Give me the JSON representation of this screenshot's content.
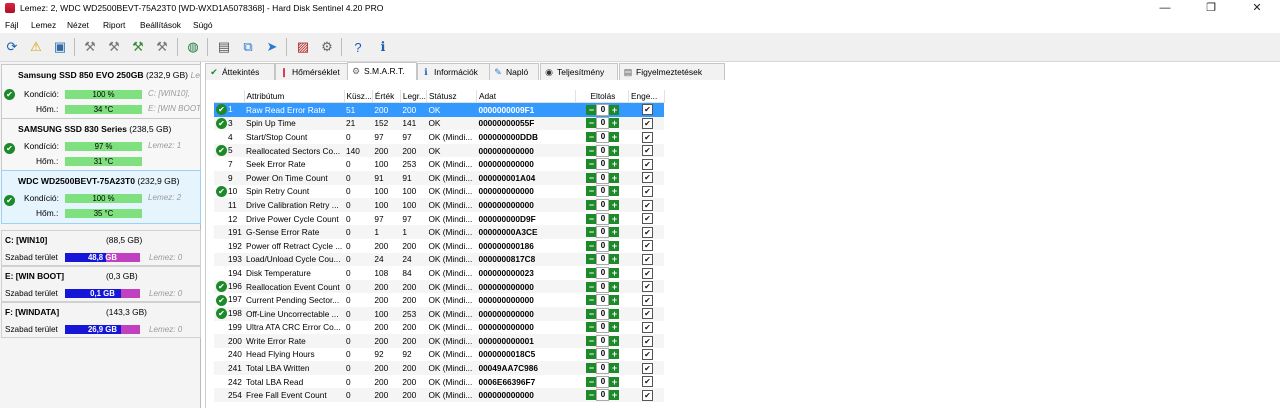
{
  "window": {
    "title": "Lemez: 2, WDC WD2500BEVT-75A23T0 [WD-WXD1A5078368]  -  Hard Disk Sentinel 4.20 PRO",
    "controls": {
      "minimize": "—",
      "maximize": "❐",
      "close": "✕"
    }
  },
  "menu": [
    {
      "label": "Fájl"
    },
    {
      "label": "Lemez"
    },
    {
      "label": "Nézet"
    },
    {
      "label": "Riport"
    },
    {
      "label": "Beállítások"
    },
    {
      "label": "Súgó"
    }
  ],
  "toolbar_icons": [
    "refresh-icon",
    "warning-icon",
    "disk-info-icon",
    "disk-test-icon-1",
    "disk-test-icon-2",
    "disk-test-icon-3",
    "disk-test-icon-4",
    "web-update-icon",
    "report-icon",
    "copy-icon",
    "send-icon",
    "chart-icon",
    "settings-icon",
    "help-icon",
    "info-icon"
  ],
  "disks": [
    {
      "name": "Samsung SSD 850 EVO 250GB",
      "size": "(232,9 GB)",
      "cut": "Le",
      "condition_label": "Kondíció:",
      "condition": "100 %",
      "condition_pct": 100,
      "temp_label": "Hőm.:",
      "temp": "34 °C",
      "side1": "C: [WIN10],",
      "side2": "E: [WIN BOOT"
    },
    {
      "name": "SAMSUNG SSD 830 Series",
      "size": "(238,5 GB)",
      "cut": "",
      "condition_label": "Kondíció:",
      "condition": "97 %",
      "condition_pct": 97,
      "temp_label": "Hőm.:",
      "temp": "31 °C",
      "side1": "Lemez: 1",
      "side2": ""
    },
    {
      "name": "WDC WD2500BEVT-75A23T0",
      "size": "(232,9 GB)",
      "cut": "",
      "condition_label": "Kondíció:",
      "condition": "100 %",
      "condition_pct": 100,
      "temp_label": "Hőm.:",
      "temp": "35 °C",
      "side1": "Lemez: 2",
      "side2": ""
    }
  ],
  "volumes": [
    {
      "name": "C: [WIN10]",
      "size": "(88,5 GB)",
      "free_label": "Szabad terület",
      "free": "48,8 GB",
      "free_pct": 55,
      "disk": "Lemez: 0"
    },
    {
      "name": "E: [WIN BOOT]",
      "size": "(0,3 GB)",
      "free_label": "Szabad terület",
      "free": "0,1 GB",
      "free_pct": 75,
      "disk": "Lemez: 0"
    },
    {
      "name": "F: [WINDATA]",
      "size": "(143,3 GB)",
      "free_label": "Szabad terület",
      "free": "26,9 GB",
      "free_pct": 75,
      "disk": "Lemez: 0"
    }
  ],
  "tabs": [
    {
      "label": "Áttekintés",
      "icon": "overview-icon",
      "glyph": "✔"
    },
    {
      "label": "Hőmérséklet",
      "icon": "temperature-icon",
      "glyph": "🌡"
    },
    {
      "label": "S.M.A.R.T.",
      "icon": "smart-icon",
      "glyph": "⚙"
    },
    {
      "label": "Információk",
      "icon": "info-icon",
      "glyph": "ℹ"
    },
    {
      "label": "Napló",
      "icon": "log-icon",
      "glyph": "✎"
    },
    {
      "label": "Teljesítmény",
      "icon": "performance-icon",
      "glyph": "◉"
    },
    {
      "label": "Figyelmeztetések",
      "icon": "alerts-icon",
      "glyph": "▤"
    }
  ],
  "smart": {
    "columns": [
      "Attribútum",
      "Küsz...",
      "Érték",
      "Legr...",
      "Státusz",
      "Adat",
      "Eltolás",
      "Enge..."
    ],
    "rows": [
      {
        "ok": true,
        "id": "1",
        "name": "Raw Read Error Rate",
        "thr": "51",
        "val": "200",
        "worst": "200",
        "status": "OK",
        "data": "0000000009F1",
        "offset": "0",
        "enabled": true
      },
      {
        "ok": true,
        "id": "3",
        "name": "Spin Up Time",
        "thr": "21",
        "val": "152",
        "worst": "141",
        "status": "OK",
        "data": "00000000055F",
        "offset": "0",
        "enabled": true
      },
      {
        "ok": false,
        "id": "4",
        "name": "Start/Stop Count",
        "thr": "0",
        "val": "97",
        "worst": "97",
        "status": "OK (Mindi...",
        "data": "000000000DDB",
        "offset": "0",
        "enabled": true
      },
      {
        "ok": true,
        "id": "5",
        "name": "Reallocated Sectors Co...",
        "thr": "140",
        "val": "200",
        "worst": "200",
        "status": "OK",
        "data": "000000000000",
        "offset": "0",
        "enabled": true
      },
      {
        "ok": false,
        "id": "7",
        "name": "Seek Error Rate",
        "thr": "0",
        "val": "100",
        "worst": "253",
        "status": "OK (Mindi...",
        "data": "000000000000",
        "offset": "0",
        "enabled": true
      },
      {
        "ok": false,
        "id": "9",
        "name": "Power On Time Count",
        "thr": "0",
        "val": "91",
        "worst": "91",
        "status": "OK (Mindi...",
        "data": "000000001A04",
        "offset": "0",
        "enabled": true
      },
      {
        "ok": true,
        "id": "10",
        "name": "Spin Retry Count",
        "thr": "0",
        "val": "100",
        "worst": "100",
        "status": "OK (Mindi...",
        "data": "000000000000",
        "offset": "0",
        "enabled": true
      },
      {
        "ok": false,
        "id": "11",
        "name": "Drive Calibration Retry ...",
        "thr": "0",
        "val": "100",
        "worst": "100",
        "status": "OK (Mindi...",
        "data": "000000000000",
        "offset": "0",
        "enabled": true
      },
      {
        "ok": false,
        "id": "12",
        "name": "Drive Power Cycle Count",
        "thr": "0",
        "val": "97",
        "worst": "97",
        "status": "OK (Mindi...",
        "data": "000000000D9F",
        "offset": "0",
        "enabled": true
      },
      {
        "ok": false,
        "id": "191",
        "name": "G-Sense Error Rate",
        "thr": "0",
        "val": "1",
        "worst": "1",
        "status": "OK (Mindi...",
        "data": "00000000A3CE",
        "offset": "0",
        "enabled": true
      },
      {
        "ok": false,
        "id": "192",
        "name": "Power off Retract Cycle ...",
        "thr": "0",
        "val": "200",
        "worst": "200",
        "status": "OK (Mindi...",
        "data": "000000000186",
        "offset": "0",
        "enabled": true
      },
      {
        "ok": false,
        "id": "193",
        "name": "Load/Unload Cycle Cou...",
        "thr": "0",
        "val": "24",
        "worst": "24",
        "status": "OK (Mindi...",
        "data": "0000000817C8",
        "offset": "0",
        "enabled": true
      },
      {
        "ok": false,
        "id": "194",
        "name": "Disk Temperature",
        "thr": "0",
        "val": "108",
        "worst": "84",
        "status": "OK (Mindi...",
        "data": "000000000023",
        "offset": "0",
        "enabled": true
      },
      {
        "ok": true,
        "id": "196",
        "name": "Reallocation Event Count",
        "thr": "0",
        "val": "200",
        "worst": "200",
        "status": "OK (Mindi...",
        "data": "000000000000",
        "offset": "0",
        "enabled": true
      },
      {
        "ok": true,
        "id": "197",
        "name": "Current Pending Sector...",
        "thr": "0",
        "val": "200",
        "worst": "200",
        "status": "OK (Mindi...",
        "data": "000000000000",
        "offset": "0",
        "enabled": true
      },
      {
        "ok": true,
        "id": "198",
        "name": "Off-Line Uncorrectable ...",
        "thr": "0",
        "val": "100",
        "worst": "253",
        "status": "OK (Mindi...",
        "data": "000000000000",
        "offset": "0",
        "enabled": true
      },
      {
        "ok": false,
        "id": "199",
        "name": "Ultra ATA CRC Error Co...",
        "thr": "0",
        "val": "200",
        "worst": "200",
        "status": "OK (Mindi...",
        "data": "000000000000",
        "offset": "0",
        "enabled": true
      },
      {
        "ok": false,
        "id": "200",
        "name": "Write Error Rate",
        "thr": "0",
        "val": "200",
        "worst": "200",
        "status": "OK (Mindi...",
        "data": "000000000001",
        "offset": "0",
        "enabled": true
      },
      {
        "ok": false,
        "id": "240",
        "name": "Head Flying Hours",
        "thr": "0",
        "val": "92",
        "worst": "92",
        "status": "OK (Mindi...",
        "data": "0000000018C5",
        "offset": "0",
        "enabled": true
      },
      {
        "ok": false,
        "id": "241",
        "name": "Total LBA Written",
        "thr": "0",
        "val": "200",
        "worst": "200",
        "status": "OK (Mindi...",
        "data": "00049AA7C986",
        "offset": "0",
        "enabled": true
      },
      {
        "ok": false,
        "id": "242",
        "name": "Total LBA Read",
        "thr": "0",
        "val": "200",
        "worst": "200",
        "status": "OK (Mindi...",
        "data": "0006E66396F7",
        "offset": "0",
        "enabled": true
      },
      {
        "ok": false,
        "id": "254",
        "name": "Free Fall Event Count",
        "thr": "0",
        "val": "200",
        "worst": "200",
        "status": "OK (Mindi...",
        "data": "000000000000",
        "offset": "0",
        "enabled": true
      }
    ]
  }
}
